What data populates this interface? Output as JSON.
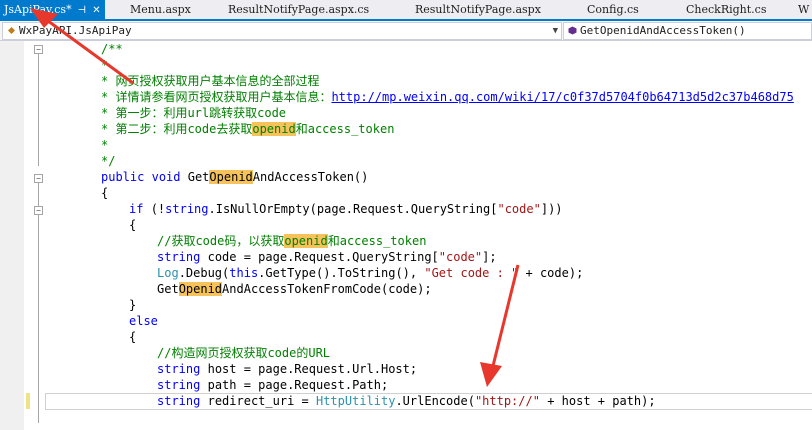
{
  "tabs": [
    {
      "label": "JsApiPay.cs*",
      "active": true
    },
    {
      "label": "Menu.aspx"
    },
    {
      "label": "ResultNotifyPage.aspx.cs"
    },
    {
      "label": "ResultNotifyPage.aspx"
    },
    {
      "label": "Config.cs"
    },
    {
      "label": "CheckRight.cs"
    },
    {
      "label": "W"
    }
  ],
  "navbar": {
    "type_name": "WxPayAPI.JsApiPay",
    "member_name": "GetOpenidAndAccessToken()"
  },
  "code": {
    "l1": "/**",
    "l2": "*",
    "l3": "* 网页授权获取用户基本信息的全部过程",
    "l4_pre": "* 详情请参看网页授权获取用户基本信息：",
    "l4_url": "http://mp.weixin.qq.com/wiki/17/c0f37d5704f0b64713d5d2c37b468d75",
    "l5": "* 第一步：利用url跳转获取code",
    "l6_a": "* 第二步：利用code去获取",
    "l6_b": "openid",
    "l6_c": "和access_token",
    "l7": "*",
    "l8": "*/",
    "l9_a": "public",
    "l9_b": "void",
    "l9_c": "Get",
    "l9_d": "Openid",
    "l9_e": "AndAccessToken()",
    "l10": "{",
    "l11_a": "if",
    "l11_b": "(!",
    "l11_c": "string",
    "l11_d": ".IsNullOrEmpty(page.Request.QueryString[",
    "l11_e": "\"code\"",
    "l11_f": "]))",
    "l12": "{",
    "l13_a": "//获取code码，以获取",
    "l13_b": "openid",
    "l13_c": "和access_token",
    "l14_a": "string",
    "l14_b": "code = page.Request.QueryString[",
    "l14_c": "\"code\"",
    "l14_d": "];",
    "l15_a": "Log",
    "l15_b": ".Debug(",
    "l15_c": "this",
    "l15_d": ".GetType().ToString(), ",
    "l15_e": "\"Get code : \"",
    "l15_f": " + code);",
    "l16_a": "Get",
    "l16_b": "Openid",
    "l16_c": "AndAccessTokenFromCode(code);",
    "l17": "}",
    "l18": "else",
    "l19": "{",
    "l20": "//构造网页授权获取code的URL",
    "l21_a": "string",
    "l21_b": "host = page.Request.Url.Host;",
    "l22_a": "string",
    "l22_b": "path = page.Request.Path;",
    "l23_a": "string",
    "l23_b": "redirect_uri = ",
    "l23_c": "HttpUtility",
    "l23_d": ".UrlEncode(",
    "l23_e": "\"http://\"",
    "l23_f": " + host + path);"
  },
  "colors": {
    "comment": "#008000",
    "keyword": "#0000ff",
    "string": "#a31515",
    "type": "#2b91af",
    "highlight": "#f5c25b",
    "accent": "#007acc",
    "annotation_arrow": "#e8372c"
  }
}
